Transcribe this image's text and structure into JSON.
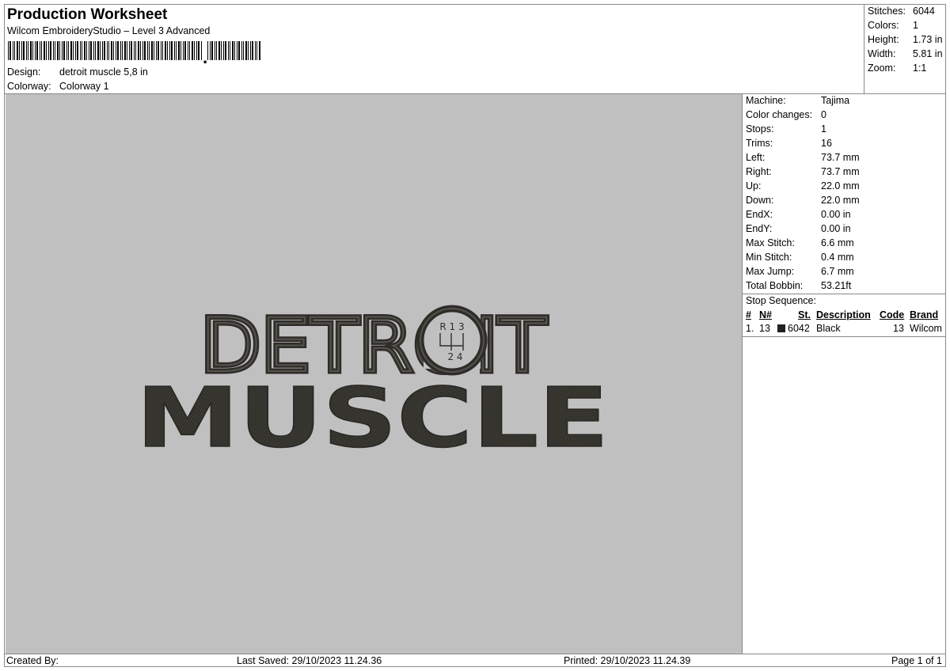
{
  "header": {
    "title": "Production Worksheet",
    "subtitle": "Wilcom EmbroideryStudio – Level 3 Advanced",
    "design_label": "Design:",
    "design_value": "detroit muscle 5,8 in",
    "colorway_label": "Colorway:",
    "colorway_value": "Colorway 1"
  },
  "summary": [
    {
      "label": "Stitches:",
      "value": "6044"
    },
    {
      "label": "Colors:",
      "value": "1"
    },
    {
      "label": "Height:",
      "value": "1.73 in"
    },
    {
      "label": "Width:",
      "value": "5.81 in"
    },
    {
      "label": "Zoom:",
      "value": "1:1"
    }
  ],
  "machine_info": [
    {
      "label": "Machine:",
      "value": "Tajima"
    },
    {
      "label": "Color changes:",
      "value": "0"
    },
    {
      "label": "Stops:",
      "value": "1"
    },
    {
      "label": "Trims:",
      "value": "16"
    },
    {
      "label": "Left:",
      "value": "73.7 mm"
    },
    {
      "label": "Right:",
      "value": "73.7 mm"
    },
    {
      "label": "Up:",
      "value": "22.0 mm"
    },
    {
      "label": "Down:",
      "value": "22.0 mm"
    },
    {
      "label": "EndX:",
      "value": "0.00 in"
    },
    {
      "label": "EndY:",
      "value": "0.00 in"
    },
    {
      "label": "Max Stitch:",
      "value": "6.6 mm"
    },
    {
      "label": "Min Stitch:",
      "value": "0.4 mm"
    },
    {
      "label": "Max Jump:",
      "value": "6.7 mm"
    },
    {
      "label": "Total Bobbin:",
      "value": "53.21ft"
    }
  ],
  "stop_sequence": {
    "label": "Stop Sequence:",
    "columns": {
      "num": "#",
      "n": "N#",
      "st": "St.",
      "description": "Description",
      "code": "Code",
      "brand": "Brand"
    },
    "rows": [
      {
        "num": "1.",
        "n": "13",
        "color": "#231f1a",
        "st": "6042",
        "description": "Black",
        "code": "13",
        "brand": "Wilcom"
      }
    ]
  },
  "design_artwork": {
    "line1": "DETROIT",
    "line2": "MUSCLE",
    "shift_pattern_top": "R 1 3",
    "shift_pattern_bottom": "2 4",
    "thread_color": "#3b3a34",
    "background_color": "#c0c0c0"
  },
  "footer": {
    "created_by": "Created By:",
    "last_saved": "Last Saved: 29/10/2023 11.24.36",
    "printed": "Printed: 29/10/2023 11.24.39",
    "page": "Page 1 of 1"
  }
}
